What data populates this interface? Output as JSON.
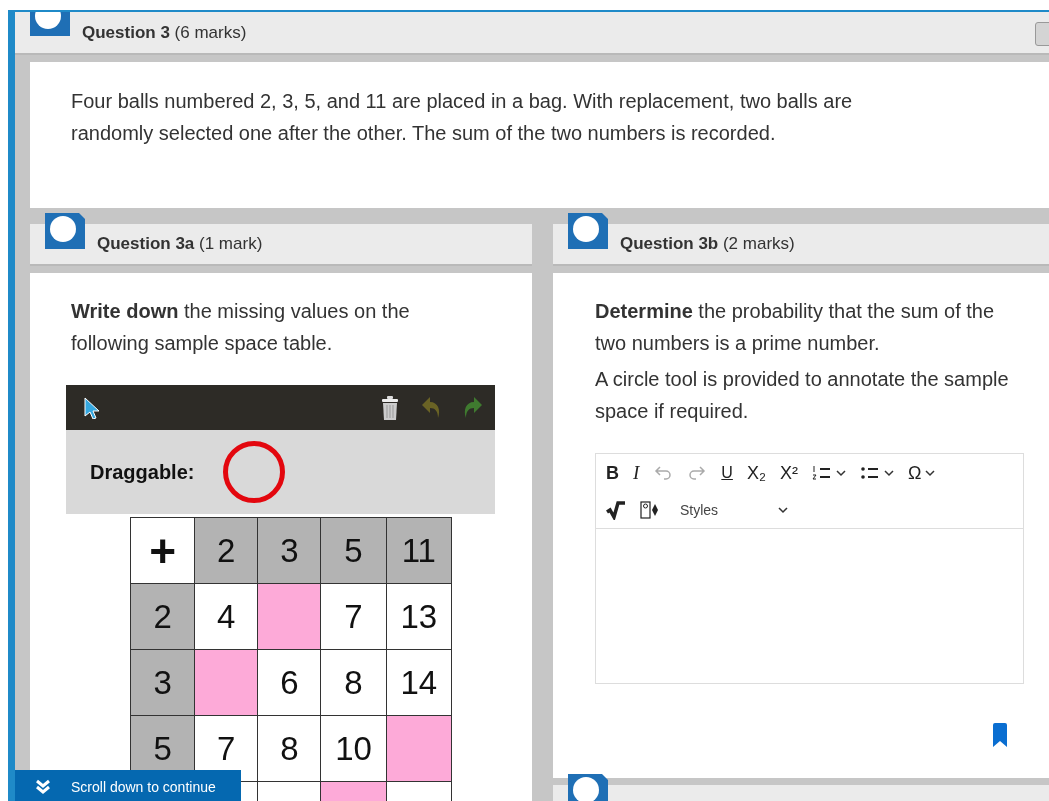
{
  "question": {
    "title": "Question 3",
    "marks": "(6 marks)",
    "stem": "Four balls numbered 2, 3, 5, and 11 are placed in a bag. With replacement, two balls are randomly selected one after the other. The sum of the two numbers is recorded."
  },
  "parts": [
    {
      "kind": "table_task",
      "title": "Question 3a",
      "marks": "(1 mark)",
      "paragraphs": [
        "**Write down** the missing values on the following sample space table."
      ],
      "draggable_label": "Draggable:",
      "table": [
        [
          {
            "kind": "corner",
            "text": "+"
          },
          {
            "kind": "header",
            "text": "2"
          },
          {
            "kind": "header",
            "text": "3"
          },
          {
            "kind": "header",
            "text": "5"
          },
          {
            "kind": "header",
            "text": "11"
          }
        ],
        [
          {
            "kind": "header",
            "text": "2"
          },
          {
            "kind": "value",
            "text": "4"
          },
          {
            "kind": "missing"
          },
          {
            "kind": "value",
            "text": "7"
          },
          {
            "kind": "value",
            "text": "13"
          }
        ],
        [
          {
            "kind": "header",
            "text": "3"
          },
          {
            "kind": "missing"
          },
          {
            "kind": "value",
            "text": "6"
          },
          {
            "kind": "value",
            "text": "8"
          },
          {
            "kind": "value",
            "text": "14"
          }
        ],
        [
          {
            "kind": "header",
            "text": "5"
          },
          {
            "kind": "value",
            "text": "7"
          },
          {
            "kind": "value",
            "text": "8"
          },
          {
            "kind": "value",
            "text": "10"
          },
          {
            "kind": "missing"
          }
        ],
        [
          {
            "kind": "header"
          },
          {
            "kind": "value"
          },
          {
            "kind": "value"
          },
          {
            "kind": "missing"
          },
          {
            "kind": "value"
          }
        ]
      ]
    },
    {
      "kind": "editor_task",
      "title": "Question 3b",
      "marks": "(2 marks)",
      "paragraphs": [
        "**Determine** the probability that the sum of the two numbers is a prime number.",
        "A circle tool is provided to annotate the sample space if required."
      ],
      "toolbar": [
        [
          {
            "kind": "bold",
            "label": "B",
            "disabled": false
          },
          {
            "kind": "italic",
            "label": "I",
            "disabled": false
          },
          {
            "kind": "undo",
            "disabled": true
          },
          {
            "kind": "redo",
            "disabled": true
          },
          {
            "kind": "underline",
            "label": "U",
            "disabled": false
          },
          {
            "kind": "subscript",
            "label": "X₂",
            "disabled": false
          },
          {
            "kind": "superscript",
            "label": "X²",
            "disabled": false
          },
          {
            "kind": "numbered-list",
            "dropdown": true,
            "disabled": false
          },
          {
            "kind": "bullet-list",
            "dropdown": true,
            "disabled": false
          },
          {
            "kind": "special",
            "label": "Ω",
            "dropdown": true,
            "disabled": false
          }
        ],
        [
          {
            "kind": "math",
            "disabled": false
          },
          {
            "kind": "image",
            "disabled": false
          },
          {
            "kind": "styles",
            "label": "Styles",
            "dropdown": true,
            "disabled": false
          }
        ]
      ]
    }
  ],
  "scroll_hint": "Scroll down to continue"
}
